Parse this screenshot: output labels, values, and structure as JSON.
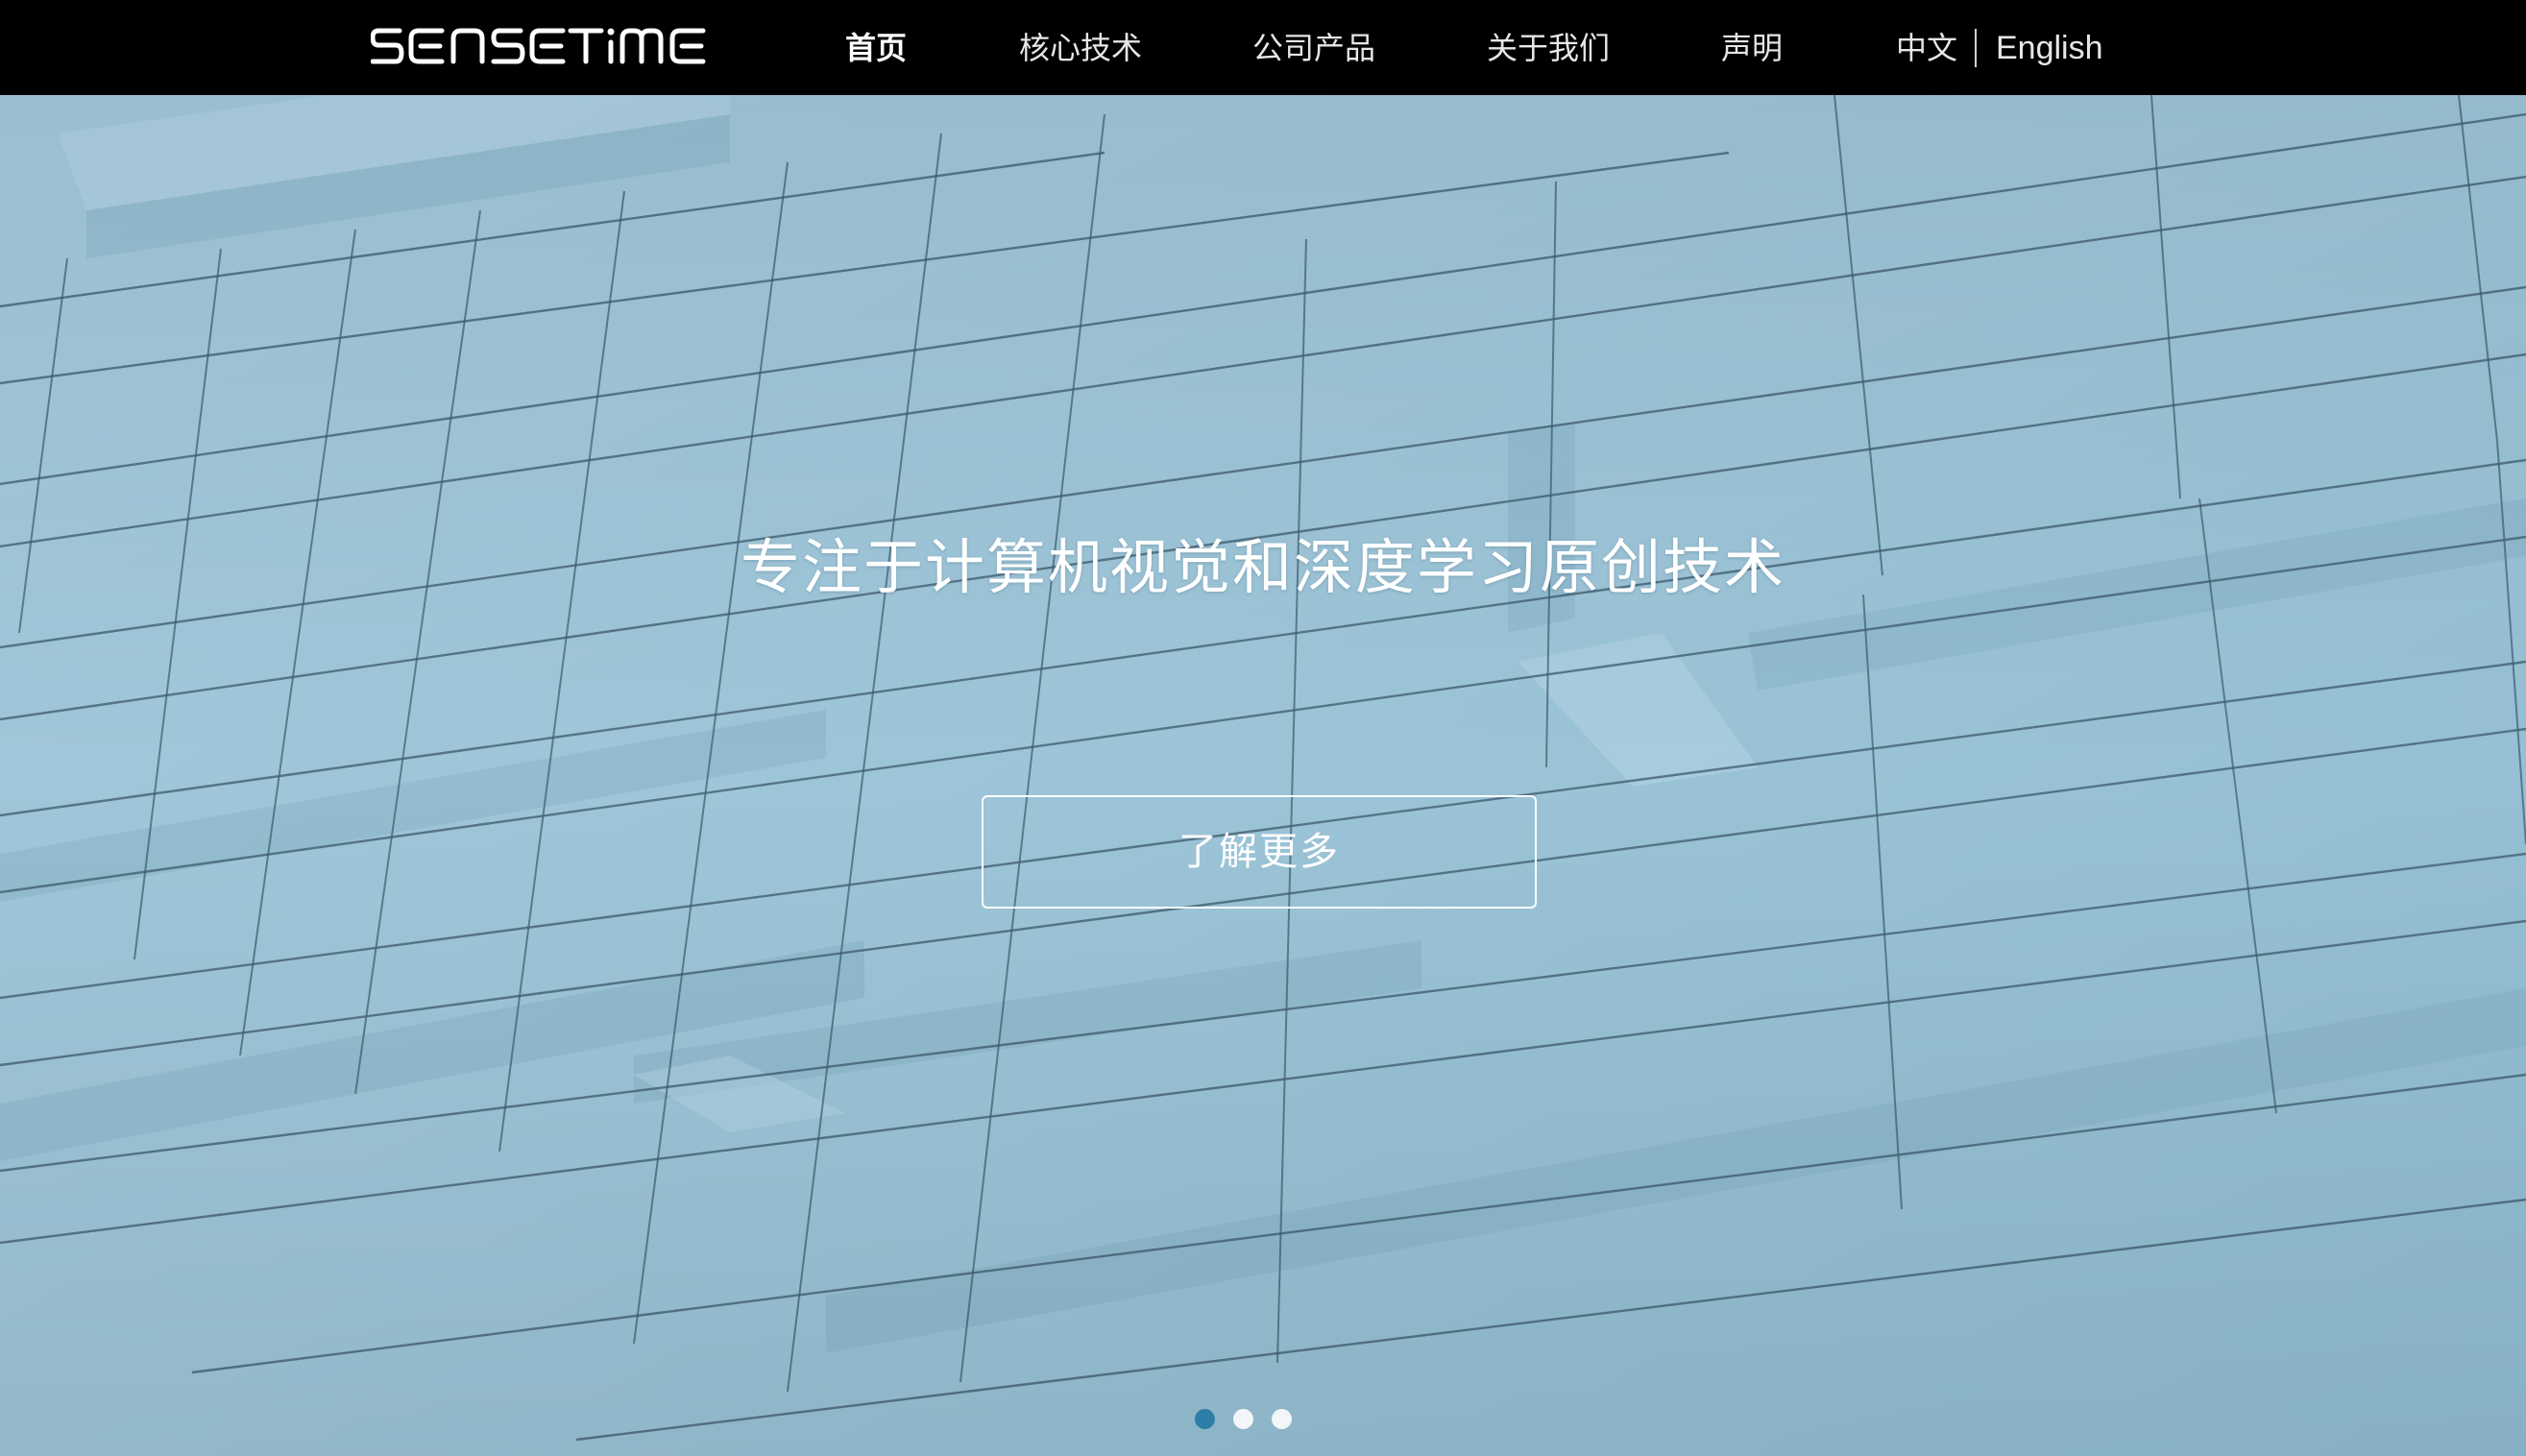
{
  "brand": {
    "logo_text": "SENSETIME"
  },
  "nav": {
    "items": [
      {
        "label": "首页",
        "active": true
      },
      {
        "label": "核心技术",
        "active": false
      },
      {
        "label": "公司产品",
        "active": false
      },
      {
        "label": "关于我们",
        "active": false
      },
      {
        "label": "声明",
        "active": false
      }
    ],
    "lang": {
      "chinese": "中文",
      "english": "English"
    }
  },
  "hero": {
    "title": "专注于计算机视觉和深度学习原创技术",
    "cta_label": "了解更多",
    "slides_count": 3,
    "active_slide": 0
  },
  "colors": {
    "navbar_bg": "#000000",
    "hero_bg": "#96c0d4",
    "active_dot": "#2d7ea6",
    "inactive_dot": "#f2f6f8"
  }
}
